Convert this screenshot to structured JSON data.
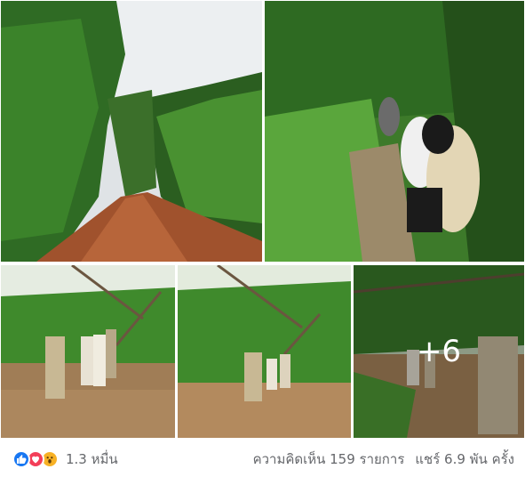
{
  "post": {
    "photos": [
      {
        "alt": "dirt road through green forest"
      },
      {
        "alt": "people wading through muddy stream in forest"
      },
      {
        "alt": "people crossing flooded river under suspension bridge"
      },
      {
        "alt": "people walking in floodwater"
      },
      {
        "alt": "people crossing flooded area"
      }
    ],
    "more_photos_label": "+6"
  },
  "footer": {
    "reaction_icons": [
      "like-icon",
      "love-icon",
      "wow-icon"
    ],
    "reaction_count": "1.3 หมื่น",
    "comments": "ความคิดเห็น 159 รายการ",
    "shares": "แชร์ 6.9 พัน ครั้ง"
  },
  "colors": {
    "like": "#1877f2",
    "love": "#f33e58",
    "wow": "#f7b125",
    "muted_text": "#65676b"
  }
}
